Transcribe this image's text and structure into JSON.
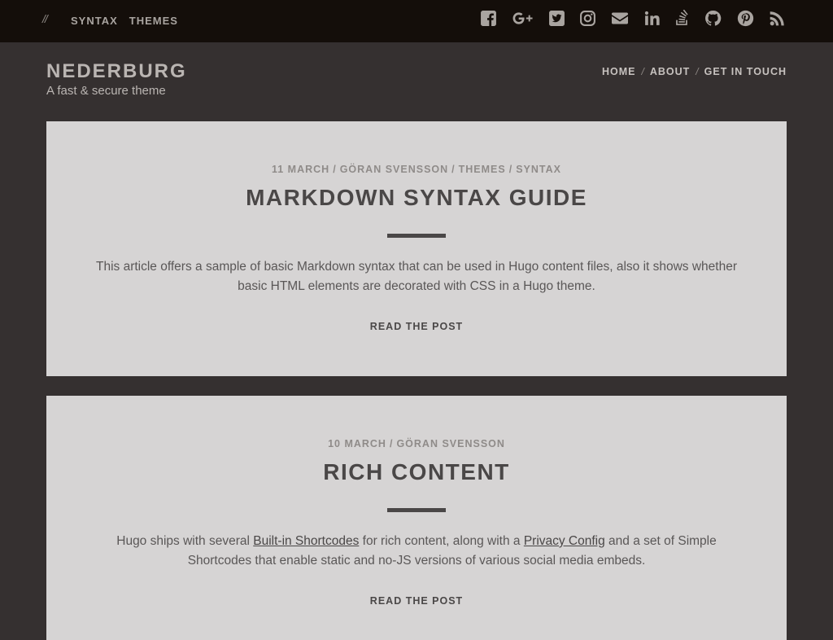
{
  "topbar": {
    "slashes": "//",
    "tags": [
      "SYNTAX",
      "THEMES"
    ],
    "social": [
      {
        "icon": "facebook-icon"
      },
      {
        "icon": "google-plus-icon"
      },
      {
        "icon": "twitter-icon"
      },
      {
        "icon": "instagram-icon"
      },
      {
        "icon": "email-icon"
      },
      {
        "icon": "linkedin-icon"
      },
      {
        "icon": "stack-overflow-icon"
      },
      {
        "icon": "github-icon"
      },
      {
        "icon": "pinterest-icon"
      },
      {
        "icon": "rss-icon"
      }
    ]
  },
  "site": {
    "title": "NEDERBURG",
    "tagline": "A fast & secure theme"
  },
  "nav": {
    "items": [
      "HOME",
      "ABOUT",
      "GET IN TOUCH"
    ],
    "separator": "/"
  },
  "posts": [
    {
      "date": "11 MARCH",
      "author": "GÖRAN SVENSSON",
      "categories": [
        "THEMES",
        "SYNTAX"
      ],
      "title": "MARKDOWN SYNTAX GUIDE",
      "excerpt": "This article offers a sample of basic Markdown syntax that can be used in Hugo content files, also it shows whether basic HTML elements are decorated with CSS in a Hugo theme.",
      "read_more": "READ THE POST"
    },
    {
      "date": "10 MARCH",
      "author": "GÖRAN SVENSSON",
      "title": "RICH CONTENT",
      "excerpt_parts": {
        "before": "Hugo ships with several ",
        "link1": "Built-in Shortcodes",
        "middle": " for rich content, along with a ",
        "link2": "Privacy Config",
        "after": " and a set of Simple Shortcodes that enable static and no-JS versions of various social media embeds."
      },
      "read_more": "READ THE POST"
    }
  ],
  "colors": {
    "topbar_bg": "#140e0a",
    "page_bg": "#353030",
    "card_bg": "#d6d4d4",
    "icon": "#a9a4a0",
    "text_dark": "#4a4747"
  }
}
